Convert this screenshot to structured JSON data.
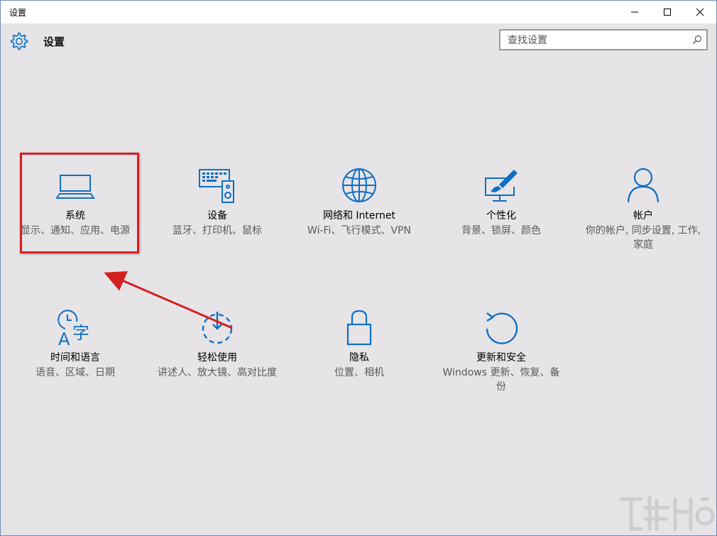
{
  "window": {
    "title": "设置"
  },
  "header": {
    "title": "设置",
    "search_placeholder": "查找设置"
  },
  "tiles": [
    {
      "name": "系统",
      "desc": "显示、通知、应用、电源",
      "icon": "laptop-icon"
    },
    {
      "name": "设备",
      "desc": "蓝牙、打印机、鼠标",
      "icon": "devices-icon"
    },
    {
      "name": "网络和 Internet",
      "desc": "Wi-Fi、飞行模式、VPN",
      "icon": "globe-icon"
    },
    {
      "name": "个性化",
      "desc": "背景、锁屏、颜色",
      "icon": "personalization-icon"
    },
    {
      "name": "帐户",
      "desc": "你的帐户, 同步设置, 工作, 家庭",
      "icon": "person-icon"
    },
    {
      "name": "时间和语言",
      "desc": "语音、区域、日期",
      "icon": "time-language-icon"
    },
    {
      "name": "轻松使用",
      "desc": "讲述人、放大镜、高对比度",
      "icon": "ease-of-access-icon"
    },
    {
      "name": "隐私",
      "desc": "位置、相机",
      "icon": "lock-icon"
    },
    {
      "name": "更新和安全",
      "desc": "Windows 更新、恢复、备份",
      "icon": "update-icon"
    }
  ],
  "colors": {
    "accent": "#0f6fc6",
    "highlight": "#d42020",
    "background": "#e6e4e6"
  }
}
